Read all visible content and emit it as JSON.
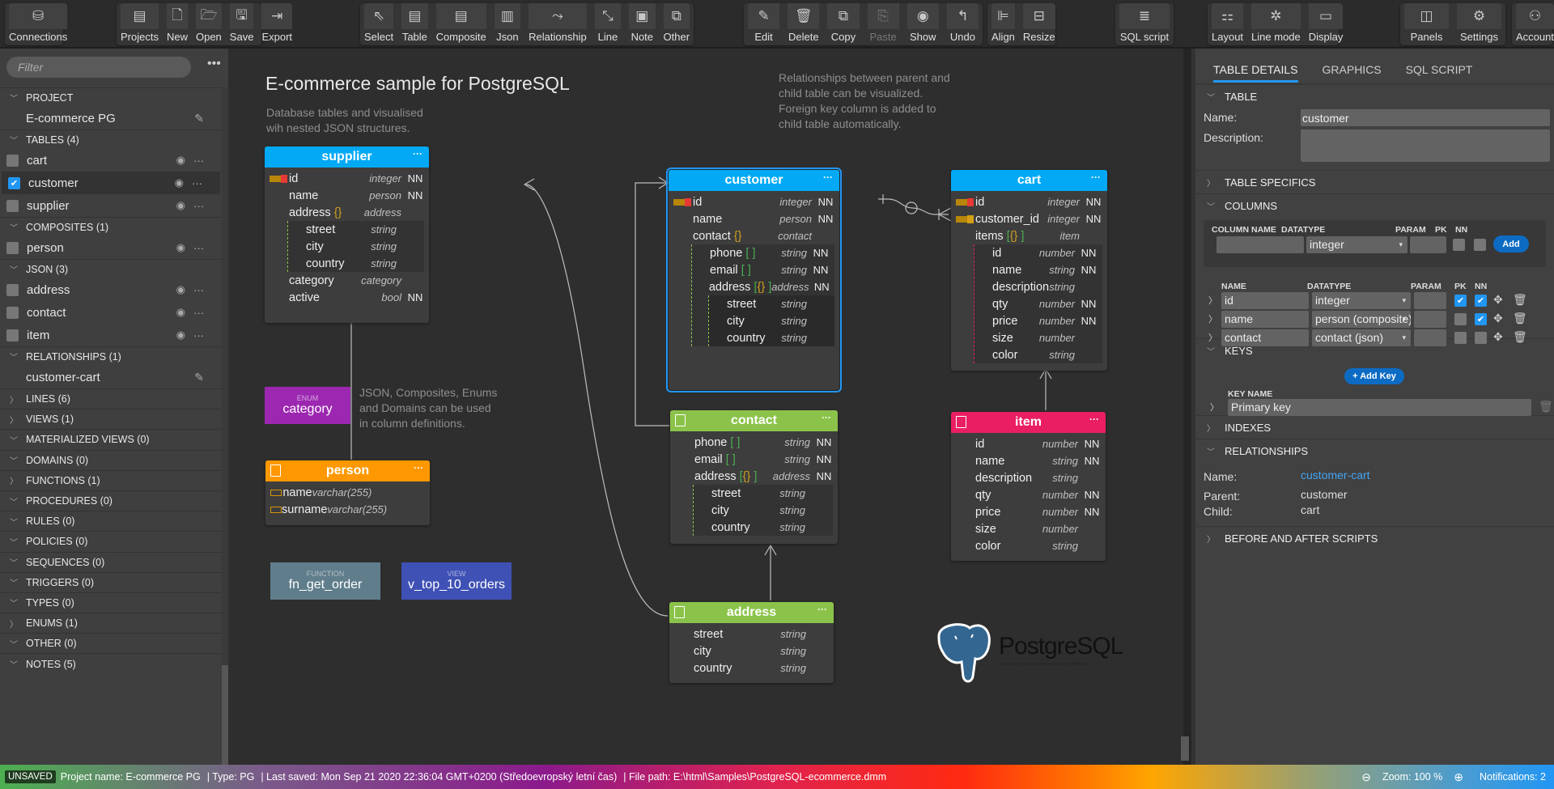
{
  "toolbar": {
    "groups": [
      [
        {
          "label": "Connections",
          "icon": "database-icon"
        }
      ],
      [
        {
          "label": "Projects",
          "icon": "projects-icon"
        },
        {
          "label": "New",
          "icon": "new-file-icon"
        },
        {
          "label": "Open",
          "icon": "folder-open-icon"
        },
        {
          "label": "Save",
          "icon": "save-icon"
        },
        {
          "label": "Export",
          "icon": "export-icon"
        }
      ],
      [
        {
          "label": "Select",
          "icon": "cursor-icon"
        },
        {
          "label": "Table",
          "icon": "table-icon"
        },
        {
          "label": "Composite",
          "icon": "composite-icon"
        },
        {
          "label": "Json",
          "icon": "json-icon"
        },
        {
          "label": "Relationship",
          "icon": "relationship-icon"
        },
        {
          "label": "Line",
          "icon": "line-icon"
        },
        {
          "label": "Note",
          "icon": "note-icon"
        },
        {
          "label": "Other",
          "icon": "other-icon"
        }
      ],
      [
        {
          "label": "Edit",
          "icon": "pencil-icon"
        },
        {
          "label": "Delete",
          "icon": "trash-icon"
        },
        {
          "label": "Copy",
          "icon": "copy-icon"
        },
        {
          "label": "Paste",
          "icon": "paste-icon",
          "disabled": true
        },
        {
          "label": "Show",
          "icon": "eye-icon"
        },
        {
          "label": "Undo",
          "icon": "undo-icon"
        }
      ],
      [
        {
          "label": "Align",
          "icon": "align-icon"
        },
        {
          "label": "Resize",
          "icon": "resize-icon"
        }
      ],
      [
        {
          "label": "SQL script",
          "icon": "sql-script-icon"
        }
      ],
      [
        {
          "label": "Layout",
          "icon": "layout-icon"
        },
        {
          "label": "Line mode",
          "icon": "line-mode-icon"
        },
        {
          "label": "Display",
          "icon": "display-icon"
        }
      ],
      [
        {
          "label": "Panels",
          "icon": "panels-icon"
        },
        {
          "label": "Settings",
          "icon": "gear-icon"
        }
      ],
      [
        {
          "label": "Account",
          "icon": "user-icon"
        }
      ]
    ]
  },
  "sidebar": {
    "filter_placeholder": "Filter",
    "project_header": "PROJECT",
    "project_name": "E-commerce PG",
    "tables_header": "TABLES (4)",
    "tables": [
      {
        "name": "cart",
        "checked": false
      },
      {
        "name": "customer",
        "checked": true
      },
      {
        "name": "supplier",
        "checked": false
      }
    ],
    "composites_header": "COMPOSITES (1)",
    "composites": [
      {
        "name": "person",
        "checked": false
      }
    ],
    "json_header": "JSON (3)",
    "json": [
      {
        "name": "address",
        "checked": false
      },
      {
        "name": "contact",
        "checked": false
      },
      {
        "name": "item",
        "checked": false
      }
    ],
    "relationships_header": "RELATIONSHIPS (1)",
    "relationship_name": "customer-cart",
    "other_sections": [
      {
        "label": "LINES (6)",
        "expanded": false
      },
      {
        "label": "VIEWS (1)",
        "expanded": false
      },
      {
        "label": "MATERIALIZED VIEWS (0)",
        "expanded": true
      },
      {
        "label": "DOMAINS (0)",
        "expanded": true
      },
      {
        "label": "FUNCTIONS (1)",
        "expanded": false
      },
      {
        "label": "PROCEDURES (0)",
        "expanded": true
      },
      {
        "label": "RULES (0)",
        "expanded": true
      },
      {
        "label": "POLICIES (0)",
        "expanded": true
      },
      {
        "label": "SEQUENCES (0)",
        "expanded": true
      },
      {
        "label": "TRIGGERS (0)",
        "expanded": true
      },
      {
        "label": "TYPES (0)",
        "expanded": true
      },
      {
        "label": "ENUMS (1)",
        "expanded": false
      },
      {
        "label": "OTHER (0)",
        "expanded": true
      },
      {
        "label": "NOTES (5)",
        "expanded": true
      }
    ]
  },
  "canvas": {
    "title": "E-commerce sample for PostgreSQL",
    "note1": "Database tables and visualised wih nested JSON structures.",
    "note2": "Relationships between parent and child table can be visualized. Foreign key column is added to child table automatically.",
    "note3": "JSON, Composites, Enums and Domains can be used in column definitions.",
    "colors": {
      "table": "#03a9f4",
      "json": "#8bc34a",
      "item": "#e91e63",
      "composite": "#ff9800",
      "enum": "#9c27b0",
      "function": "#607d8b",
      "view": "#3f51b5"
    },
    "supplier": {
      "name": "supplier",
      "more": "···",
      "rows": [
        {
          "n": "id",
          "t": "integer",
          "nn": "NN",
          "key": "pk"
        },
        {
          "n": "name",
          "t": "person",
          "nn": "NN"
        },
        {
          "n": "address",
          "br": "{}",
          "t": "address",
          "nn": ""
        },
        {
          "n": "street",
          "t": "string",
          "nn": "",
          "nested": 1
        },
        {
          "n": "city",
          "t": "string",
          "nn": "",
          "nested": 1
        },
        {
          "n": "country",
          "t": "string",
          "nn": "",
          "nested": 1
        },
        {
          "n": "category",
          "t": "category",
          "nn": ""
        },
        {
          "n": "active",
          "t": "bool",
          "nn": "NN"
        }
      ]
    },
    "customer": {
      "name": "customer",
      "more": "···",
      "rows": [
        {
          "n": "id",
          "t": "integer",
          "nn": "NN",
          "key": "pk"
        },
        {
          "n": "name",
          "t": "person",
          "nn": "NN"
        },
        {
          "n": "contact",
          "br": "{}",
          "t": "contact",
          "nn": ""
        },
        {
          "n": "phone",
          "br": "[ ]",
          "t": "string",
          "nn": "NN",
          "nested": 1
        },
        {
          "n": "email",
          "br": "[ ]",
          "t": "string",
          "nn": "NN",
          "nested": 1
        },
        {
          "n": "address",
          "br": "[{} ]",
          "t": "address",
          "nn": "NN",
          "nested": 1
        },
        {
          "n": "street",
          "t": "string",
          "nn": "",
          "nested": 2
        },
        {
          "n": "city",
          "t": "string",
          "nn": "",
          "nested": 2
        },
        {
          "n": "country",
          "t": "string",
          "nn": "",
          "nested": 2
        }
      ]
    },
    "cart": {
      "name": "cart",
      "more": "···",
      "rows": [
        {
          "n": "id",
          "t": "integer",
          "nn": "NN",
          "key": "pk"
        },
        {
          "n": "customer_id",
          "t": "integer",
          "nn": "NN",
          "key": "fk"
        },
        {
          "n": "items",
          "br": "[{} ]",
          "t": "item",
          "nn": ""
        },
        {
          "n": "id",
          "t": "number",
          "nn": "NN",
          "nested": 1
        },
        {
          "n": "name",
          "t": "string",
          "nn": "NN",
          "nested": 1
        },
        {
          "n": "description",
          "t": "string",
          "nn": "",
          "nested": 1
        },
        {
          "n": "qty",
          "t": "number",
          "nn": "NN",
          "nested": 1
        },
        {
          "n": "price",
          "t": "number",
          "nn": "NN",
          "nested": 1
        },
        {
          "n": "size",
          "t": "number",
          "nn": "",
          "nested": 1
        },
        {
          "n": "color",
          "t": "string",
          "nn": "",
          "nested": 1
        }
      ]
    },
    "contact": {
      "name": "contact",
      "more": "···",
      "rows": [
        {
          "n": "phone",
          "br": "[ ]",
          "t": "string",
          "nn": "NN"
        },
        {
          "n": "email",
          "br": "[ ]",
          "t": "string",
          "nn": "NN"
        },
        {
          "n": "address",
          "br": "[{} ]",
          "t": "address",
          "nn": "NN"
        },
        {
          "n": "street",
          "t": "string",
          "nn": "",
          "nested": 1
        },
        {
          "n": "city",
          "t": "string",
          "nn": "",
          "nested": 1
        },
        {
          "n": "country",
          "t": "string",
          "nn": "",
          "nested": 1
        }
      ]
    },
    "item": {
      "name": "item",
      "more": "···",
      "rows": [
        {
          "n": "id",
          "t": "number",
          "nn": "NN"
        },
        {
          "n": "name",
          "t": "string",
          "nn": "NN"
        },
        {
          "n": "description",
          "t": "string",
          "nn": ""
        },
        {
          "n": "qty",
          "t": "number",
          "nn": "NN"
        },
        {
          "n": "price",
          "t": "number",
          "nn": "NN"
        },
        {
          "n": "size",
          "t": "number",
          "nn": ""
        },
        {
          "n": "color",
          "t": "string",
          "nn": ""
        }
      ]
    },
    "address": {
      "name": "address",
      "more": "···",
      "rows": [
        {
          "n": "street",
          "t": "string",
          "nn": ""
        },
        {
          "n": "city",
          "t": "string",
          "nn": ""
        },
        {
          "n": "country",
          "t": "string",
          "nn": ""
        }
      ]
    },
    "person": {
      "name": "person",
      "more": "···",
      "rows": [
        {
          "n": "name",
          "t": "varchar(255)"
        },
        {
          "n": "surname",
          "t": "varchar(255)"
        }
      ]
    },
    "enum": {
      "type": "ENUM",
      "name": "category"
    },
    "function": {
      "type": "FUNCTION",
      "name": "fn_get_order"
    },
    "view": {
      "type": "VIEW",
      "name": "v_top_10_orders"
    },
    "logo": {
      "name": "PostgreSQL",
      "tagline": "the world's most advanced open source database"
    }
  },
  "panel": {
    "tabs": [
      "TABLE DETAILS",
      "GRAPHICS",
      "SQL SCRIPT"
    ],
    "active_tab": 0,
    "table_section": "TABLE",
    "name_label": "Name:",
    "name_value": "customer",
    "description_label": "Description:",
    "description_value": "",
    "table_specifics": "TABLE SPECIFICS",
    "columns_section": "COLUMNS",
    "add_headers": [
      "COLUMN NAME",
      "DATATYPE",
      "PARAM",
      "PK",
      "NN"
    ],
    "add_datatype": "integer",
    "add_button": "Add",
    "list_headers": [
      "NAME",
      "DATATYPE",
      "PARAM",
      "PK",
      "NN"
    ],
    "columns": [
      {
        "name": "id",
        "datatype": "integer",
        "param": "",
        "pk": true,
        "nn": true
      },
      {
        "name": "name",
        "datatype": "person (composite)",
        "param": "",
        "pk": false,
        "nn": true
      },
      {
        "name": "contact",
        "datatype": "contact (json)",
        "param": "",
        "pk": false,
        "nn": false
      }
    ],
    "keys_section": "KEYS",
    "add_key_button": "+ Add Key",
    "key_name_header": "KEY NAME",
    "keys": [
      "Primary key"
    ],
    "indexes_section": "INDEXES",
    "relationships_section": "RELATIONSHIPS",
    "rel_name_label": "Name:",
    "rel_name": "customer-cart",
    "rel_parent_label": "Parent:",
    "rel_parent": "customer",
    "rel_child_label": "Child:",
    "rel_child": "cart",
    "scripts_section": "BEFORE AND AFTER SCRIPTS"
  },
  "status": {
    "unsaved": "UNSAVED",
    "project": "Project name: E-commerce PG",
    "type": "| Type: PG",
    "last_saved": "| Last saved: Mon Sep 21 2020 22:36:04 GMT+0200 (Středoevropský letní čas)",
    "file_path": "| File path: E:\\html\\Samples\\PostgreSQL-ecommerce.dmm",
    "zoom": "Zoom: 100 %",
    "notifications": "Notifications: 2"
  }
}
